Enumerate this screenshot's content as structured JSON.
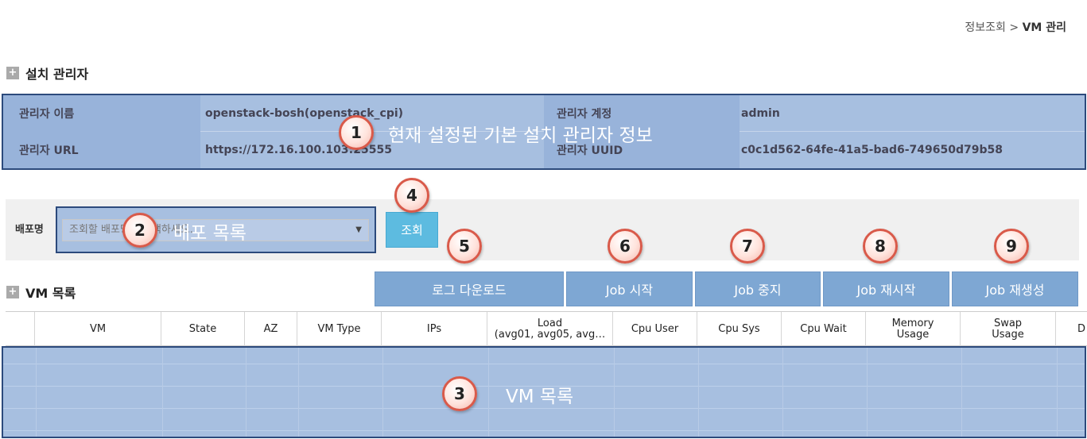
{
  "breadcrumb": {
    "parent": "정보조회",
    "separator": " > ",
    "current": "VM 관리"
  },
  "install_admin": {
    "title": "설치 관리자",
    "name_label": "관리자 이름",
    "name_value": "openstack-bosh(openstack_cpi)",
    "account_label": "관리자 계정",
    "account_value": "admin",
    "url_label": "관리자 URL",
    "url_value": "https://172.16.100.103:25555",
    "uuid_label": "관리자 UUID",
    "uuid_value": "c0c1d562-64fe-41a5-bad6-749650d79b58"
  },
  "deploy_filter": {
    "label": "배포명",
    "placeholder": "조회할 배포명을 선택하세요.",
    "search_button": "조회"
  },
  "vm_list": {
    "title": "VM 목록",
    "buttons": [
      "로그 다운로드",
      "Job 시작",
      "Job 중지",
      "Job 재시작",
      "Job 재생성"
    ],
    "columns": [
      {
        "line1": "VM",
        "line2": ""
      },
      {
        "line1": "State",
        "line2": ""
      },
      {
        "line1": "AZ",
        "line2": ""
      },
      {
        "line1": "VM Type",
        "line2": ""
      },
      {
        "line1": "IPs",
        "line2": ""
      },
      {
        "line1": "Load",
        "line2": "(avg01, avg05, avg…"
      },
      {
        "line1": "Cpu User",
        "line2": ""
      },
      {
        "line1": "Cpu Sys",
        "line2": ""
      },
      {
        "line1": "Cpu Wait",
        "line2": ""
      },
      {
        "line1": "Memory",
        "line2": "Usage"
      },
      {
        "line1": "Swap",
        "line2": "Usage"
      },
      {
        "line1": "D",
        "line2": ""
      }
    ]
  },
  "callouts": [
    {
      "number": "1",
      "text": "현재 설정된 기본 설치 관리자 정보"
    },
    {
      "number": "2",
      "text": "배포 목록"
    },
    {
      "number": "3",
      "text": "VM 목록"
    },
    {
      "number": "4",
      "text": ""
    },
    {
      "number": "5",
      "text": ""
    },
    {
      "number": "6",
      "text": ""
    },
    {
      "number": "7",
      "text": ""
    },
    {
      "number": "8",
      "text": ""
    },
    {
      "number": "9",
      "text": ""
    }
  ],
  "colors": {
    "highlight_fill": "#a7bfe0",
    "highlight_border": "#2c4a7c",
    "button_blue": "#7ea7d3",
    "search_button": "#5dbbe0",
    "callout_border": "#d95a4a"
  }
}
